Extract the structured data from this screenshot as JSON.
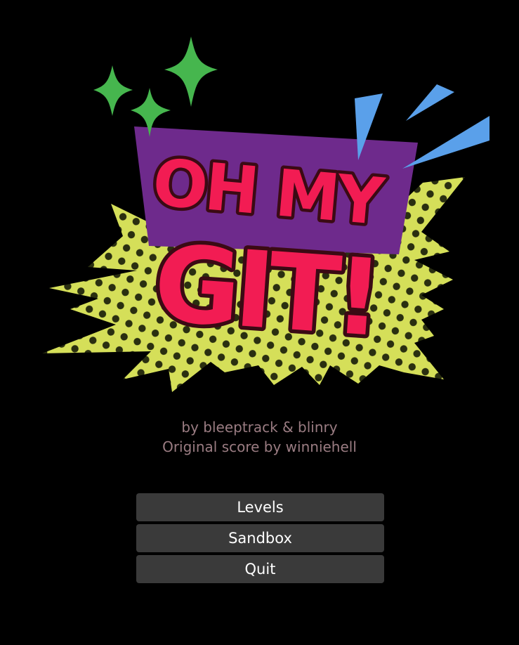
{
  "logo": {
    "line1": "OH MY",
    "line2": "GIT!",
    "colors": {
      "letters": "#f21c53",
      "letter_outline": "#3b0a14",
      "panel": "#6e2a8c",
      "burst": "#d5df59",
      "dots": "#2a2f10",
      "sparkles": "#46b64e",
      "shards": "#5aa0ea"
    }
  },
  "credits": {
    "authors": "by bleeptrack & blinry",
    "score": "Original score by winniehell"
  },
  "menu": {
    "items": [
      {
        "label": "Levels"
      },
      {
        "label": "Sandbox"
      },
      {
        "label": "Quit"
      }
    ]
  },
  "colors": {
    "background": "#000000",
    "credits_text": "#9a7c82",
    "button_bg": "#3a3a3a",
    "button_text": "#ffffff"
  }
}
